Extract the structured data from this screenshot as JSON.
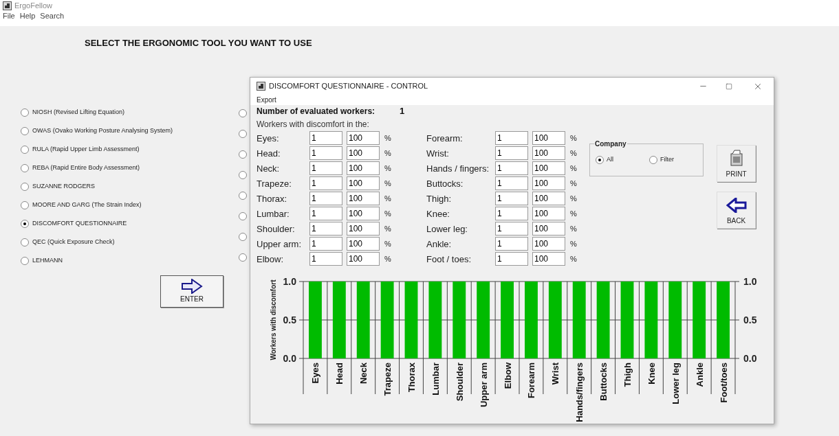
{
  "app": {
    "title": "ErgoFellow",
    "menu": [
      "File",
      "Help",
      "Search"
    ],
    "heading": "SELECT THE ERGONOMIC TOOL YOU WANT TO USE",
    "tools": [
      {
        "label": "NIOSH  (Revised Lifting Equation)",
        "selected": false
      },
      {
        "label": "OWAS  (Ovako Working Posture Analysing System)",
        "selected": false
      },
      {
        "label": "RULA  (Rapid Upper Limb Assessment)",
        "selected": false
      },
      {
        "label": "REBA  (Rapid Entire Body Assessment)",
        "selected": false
      },
      {
        "label": "SUZANNE RODGERS",
        "selected": false
      },
      {
        "label": "MOORE AND GARG (The Strain Index)",
        "selected": false
      },
      {
        "label": "DISCOMFORT QUESTIONNAIRE",
        "selected": true
      },
      {
        "label": "QEC  (Quick Exposure Check)",
        "selected": false
      },
      {
        "label": "LEHMANN",
        "selected": false
      }
    ],
    "second_column_options": [
      {
        "selected": false
      },
      {
        "selected": false
      },
      {
        "selected": false
      },
      {
        "selected": false
      },
      {
        "selected": false
      },
      {
        "selected": false
      },
      {
        "selected": false
      },
      {
        "selected": false
      }
    ],
    "enter_button": "ENTER"
  },
  "dialog": {
    "title": "DISCOMFORT QUESTIONNAIRE - CONTROL",
    "menu": [
      "Export"
    ],
    "evaluated_label": "Number of evaluated workers:",
    "evaluated_value": "1",
    "section_label": "Workers with discomfort in the:",
    "body_parts": [
      {
        "label": "Eyes:",
        "count": "1",
        "percent": "100",
        "unit": "%"
      },
      {
        "label": "Head:",
        "count": "1",
        "percent": "100",
        "unit": "%"
      },
      {
        "label": "Neck:",
        "count": "1",
        "percent": "100",
        "unit": "%"
      },
      {
        "label": "Trapeze:",
        "count": "1",
        "percent": "100",
        "unit": "%"
      },
      {
        "label": "Thorax:",
        "count": "1",
        "percent": "100",
        "unit": "%"
      },
      {
        "label": "Lumbar:",
        "count": "1",
        "percent": "100",
        "unit": "%"
      },
      {
        "label": "Shoulder:",
        "count": "1",
        "percent": "100",
        "unit": "%"
      },
      {
        "label": "Upper arm:",
        "count": "1",
        "percent": "100",
        "unit": "%"
      },
      {
        "label": "Elbow:",
        "count": "1",
        "percent": "100",
        "unit": "%"
      },
      {
        "label": "Forearm:",
        "count": "1",
        "percent": "100",
        "unit": "%"
      },
      {
        "label": "Wrist:",
        "count": "1",
        "percent": "100",
        "unit": "%"
      },
      {
        "label": "Hands / fingers:",
        "count": "1",
        "percent": "100",
        "unit": "%"
      },
      {
        "label": "Buttocks:",
        "count": "1",
        "percent": "100",
        "unit": "%"
      },
      {
        "label": "Thigh:",
        "count": "1",
        "percent": "100",
        "unit": "%"
      },
      {
        "label": "Knee:",
        "count": "1",
        "percent": "100",
        "unit": "%"
      },
      {
        "label": "Lower leg:",
        "count": "1",
        "percent": "100",
        "unit": "%"
      },
      {
        "label": "Ankle:",
        "count": "1",
        "percent": "100",
        "unit": "%"
      },
      {
        "label": "Foot / toes:",
        "count": "1",
        "percent": "100",
        "unit": "%"
      }
    ],
    "company": {
      "title": "Company",
      "options": [
        {
          "label": "All",
          "selected": true
        },
        {
          "label": "Filter",
          "selected": false
        }
      ]
    },
    "buttons": [
      {
        "kind": "print",
        "label": "PRINT"
      },
      {
        "kind": "back",
        "label": "BACK"
      }
    ],
    "chart_data": {
      "type": "bar",
      "ylabel": "Workers with discomfort",
      "categories": [
        "Eyes",
        "Head",
        "Neck",
        "Trapeze",
        "Thorax",
        "Lumbar",
        "Shoulder",
        "Upper arm",
        "Elbow",
        "Forearm",
        "Wrist",
        "Hands/fingers",
        "Buttocks",
        "Thigh",
        "Knee",
        "Lower leg",
        "Ankle",
        "Foot/toes"
      ],
      "series": [
        {
          "color": "#00bb00",
          "values": [
            1,
            1,
            1,
            1,
            1,
            1,
            1,
            1,
            1,
            1,
            1,
            1,
            1,
            1,
            1,
            1,
            1,
            1
          ]
        }
      ],
      "ylim": [
        0,
        1
      ],
      "yticks": [
        {
          "value": 0,
          "label": "0.0"
        },
        {
          "value": 0.5,
          "label": "0.5"
        },
        {
          "value": 1,
          "label": "1.0"
        }
      ]
    }
  }
}
